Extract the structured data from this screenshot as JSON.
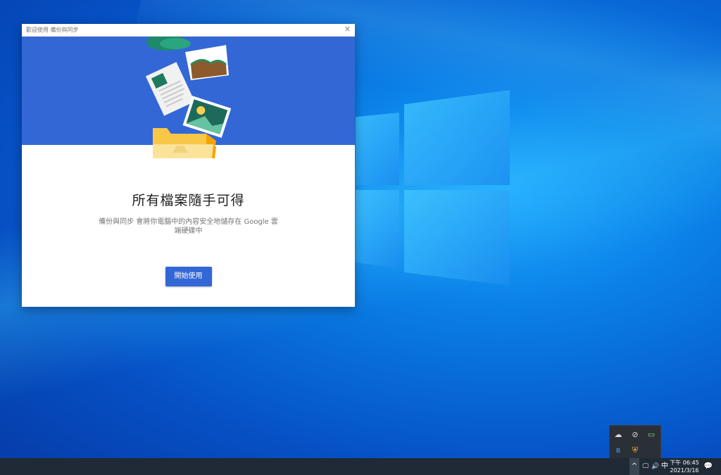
{
  "window": {
    "title": "歡迎使用 備份與同步",
    "close_glyph": "✕"
  },
  "main": {
    "headline": "所有檔案隨手可得",
    "description": "備份與同步 會將你電腦中的內容安全地儲存在 Google 雲端硬碟中",
    "start_button": "開始使用"
  },
  "tray_popup": {
    "icons": [
      "cloud-upload-icon",
      "sync-off-icon",
      "chat-icon",
      "bluetooth-icon",
      "security-shield-icon"
    ]
  },
  "taskbar": {
    "chevron": "^",
    "network_glyph": "🖵",
    "volume_glyph": "🔊",
    "ime_label": "中",
    "time": "下午 06:45",
    "date": "2021/3/16",
    "notification_glyph": "💬"
  },
  "colors": {
    "accent": "#3367d6",
    "taskbar": "#1f2a36"
  }
}
